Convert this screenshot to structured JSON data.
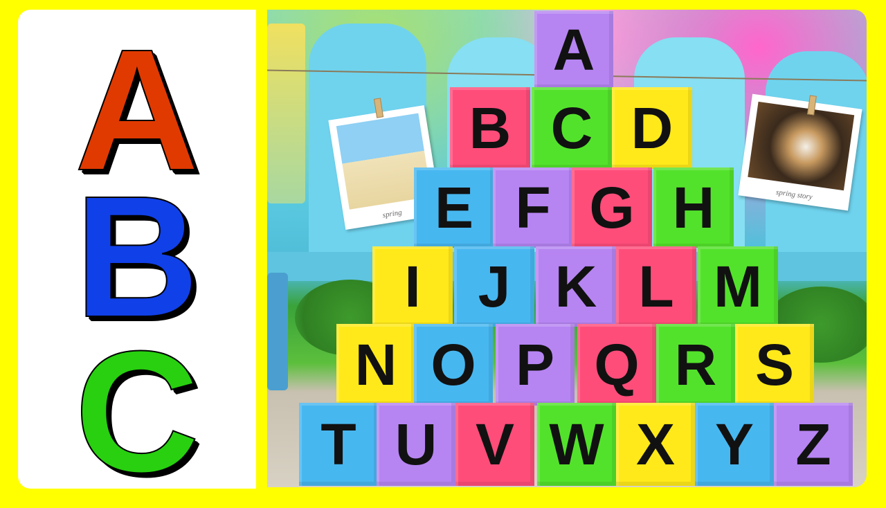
{
  "left_letters": [
    {
      "letter": "A",
      "color": "#e03a00"
    },
    {
      "letter": "B",
      "color": "#1040e8"
    },
    {
      "letter": "C",
      "color": "#28d010"
    }
  ],
  "photos": [
    {
      "caption": "spring"
    },
    {
      "caption": "spring story"
    }
  ],
  "colors": {
    "purple": "#b685f2",
    "red": "#ff4d7a",
    "green": "#53e22b",
    "yellow": "#ffe91a",
    "blue": "#47b7f0"
  },
  "rows": [
    [
      {
        "l": "A",
        "c": "purple"
      }
    ],
    [
      {
        "l": "B",
        "c": "red"
      },
      {
        "l": "C",
        "c": "green"
      },
      {
        "l": "D",
        "c": "yellow"
      }
    ],
    [
      {
        "l": "E",
        "c": "blue"
      },
      {
        "l": "F",
        "c": "purple"
      },
      {
        "l": "G",
        "c": "red"
      },
      {
        "l": "H",
        "c": "green"
      }
    ],
    [
      {
        "l": "I",
        "c": "yellow"
      },
      {
        "l": "J",
        "c": "blue"
      },
      {
        "l": "K",
        "c": "purple"
      },
      {
        "l": "L",
        "c": "red"
      },
      {
        "l": "M",
        "c": "green"
      }
    ],
    [
      {
        "l": "N",
        "c": "yellow"
      },
      {
        "l": "O",
        "c": "blue"
      },
      {
        "l": "P",
        "c": "purple"
      },
      {
        "l": "Q",
        "c": "red"
      },
      {
        "l": "R",
        "c": "green"
      },
      {
        "l": "S",
        "c": "yellow"
      }
    ],
    [
      {
        "l": "T",
        "c": "blue"
      },
      {
        "l": "U",
        "c": "purple"
      },
      {
        "l": "V",
        "c": "red"
      },
      {
        "l": "W",
        "c": "green"
      },
      {
        "l": "X",
        "c": "yellow"
      },
      {
        "l": "Y",
        "c": "blue"
      },
      {
        "l": "Z",
        "c": "purple"
      }
    ]
  ]
}
